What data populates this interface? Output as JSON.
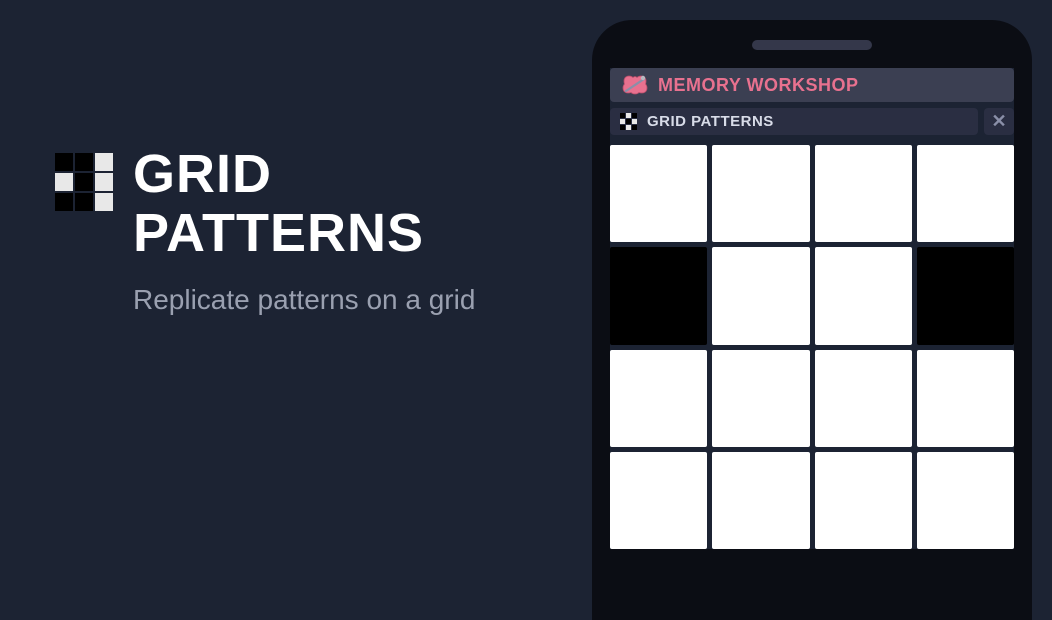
{
  "promo": {
    "title_line1": "GRID",
    "title_line2": "PATTERNS",
    "subtitle": "Replicate patterns on a grid",
    "icon_pattern": [
      1,
      1,
      0,
      0,
      1,
      0,
      1,
      1,
      0
    ]
  },
  "app": {
    "header_title": "MEMORY WORKSHOP",
    "subheader_title": "GRID PATTERNS",
    "subheader_icon_pattern": [
      1,
      0,
      1,
      0,
      1,
      0,
      1,
      0,
      1
    ],
    "close_label": "✕",
    "grid": {
      "cols": 4,
      "rows": 4,
      "cells": [
        0,
        0,
        0,
        0,
        1,
        0,
        0,
        1,
        0,
        0,
        0,
        0,
        0,
        0,
        0,
        0
      ]
    }
  },
  "colors": {
    "bg": "#1c2333",
    "accent": "#e8718f",
    "frame": "#0b0d14"
  }
}
